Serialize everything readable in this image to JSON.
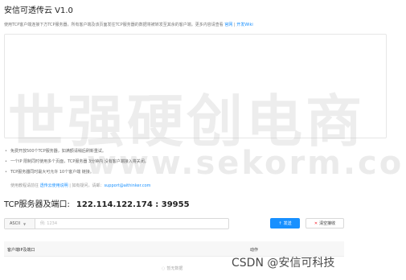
{
  "app": {
    "title": "安信可透传云 V1.0"
  },
  "description": {
    "text": "使用TCP客户端连接下方TCP服务器，所有客户端及该页面发往TCP服务器的数据将被转发至其余的客户端。更多内容请查看",
    "official_link": "官网",
    "separator": " | ",
    "wiki_link": "开发Wiki"
  },
  "notes": [
    "免费开放500个TCP服务器，如满额请稍后刷新重试。",
    "一个IP 限制同时使用多个页面，TCP服务器 3分钟内 没有客户端接入将关闭。",
    "TCP服务器同时最大可允许 10个客户端 链接。"
  ],
  "contact": {
    "prefix": "使用教程请前往",
    "tutorial_link": "透传云使用说明",
    "middle": " | 如有疑问，请邮：",
    "email": "support@aithinker.com"
  },
  "server": {
    "label": "TCP服务器及端口:",
    "address": "122.114.122.174 : 39955"
  },
  "input": {
    "encoding": "ASCII",
    "placeholder": "例: 1234"
  },
  "buttons": {
    "send": "发送",
    "clear": "清空接收"
  },
  "table": {
    "headers": [
      "客户端IP及端口",
      "动作"
    ],
    "empty_text": "暂无数据"
  },
  "watermarks": {
    "large": "世强硬创电商",
    "small": "www.sekorm.com",
    "csdn": "CSDN @安信可科技"
  },
  "colors": {
    "accent": "#1890ff",
    "danger": "#f5222d"
  }
}
